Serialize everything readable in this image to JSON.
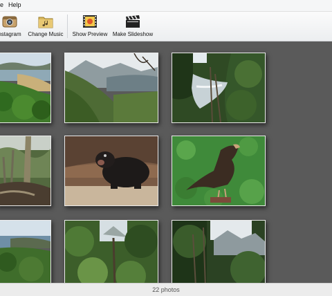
{
  "menu": {
    "items": [
      {
        "label": "e"
      },
      {
        "label": "Help"
      }
    ]
  },
  "toolbar": {
    "buttons": [
      {
        "label": "nstagram",
        "icon": "camera-icon"
      },
      {
        "label": "Change Music",
        "icon": "music-folder-icon"
      },
      {
        "label": "Show Preview",
        "icon": "film-preview-icon"
      },
      {
        "label": "Make Slideshow",
        "icon": "clapperboard-icon"
      }
    ]
  },
  "gallery": {
    "photos": [
      {
        "subject": "coastal bay"
      },
      {
        "subject": "forested hills"
      },
      {
        "subject": "river in forest"
      },
      {
        "subject": "forest trees"
      },
      {
        "subject": "tasmanian devil"
      },
      {
        "subject": "eagle on shrubs"
      },
      {
        "subject": "coastline"
      },
      {
        "subject": "ferns and forest"
      },
      {
        "subject": "mountain forest"
      }
    ]
  },
  "status": {
    "text": "22 photos"
  },
  "colors": {
    "gallery_background": "#5a5a5a",
    "toolbar": "#eef0f2"
  }
}
